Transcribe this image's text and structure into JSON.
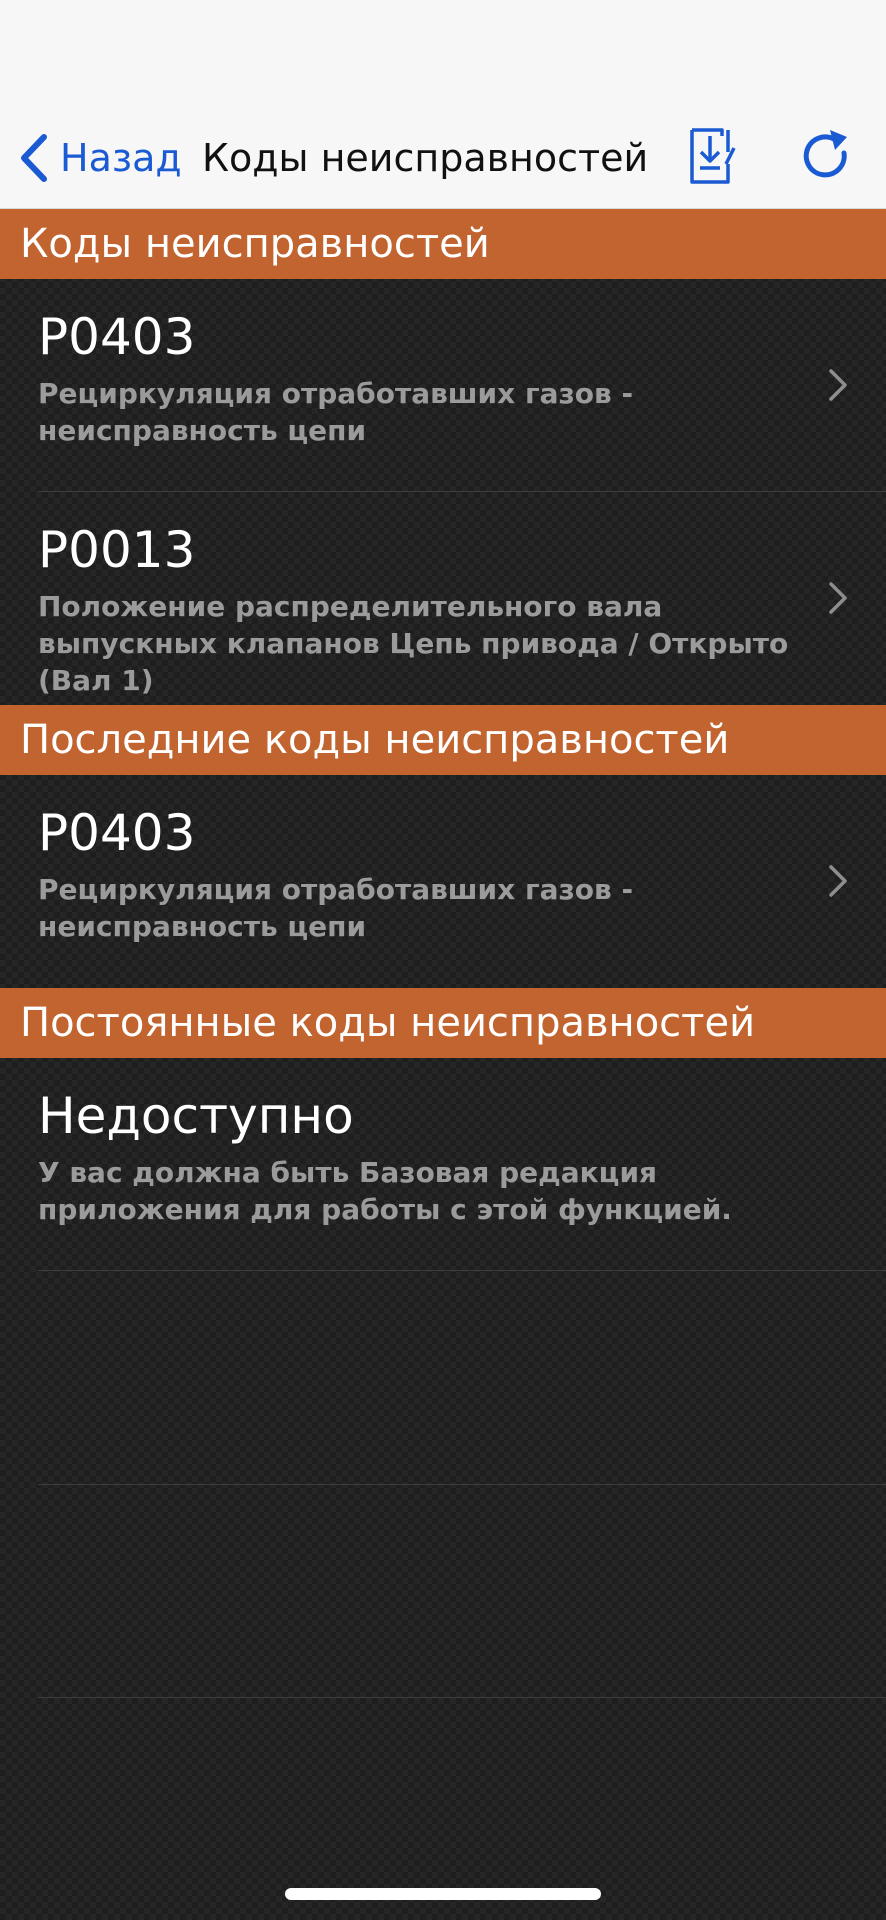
{
  "nav": {
    "back_label": "Назад",
    "title": "Коды неисправностей"
  },
  "sections": {
    "current": {
      "header": "Коды неисправностей",
      "items": [
        {
          "code": "P0403",
          "description": "Рециркуляция отработавших газов - неисправность цепи"
        },
        {
          "code": "P0013",
          "description": "Положение распределительного вала выпускных клапанов Цепь привода / Открыто (Вал 1)"
        }
      ]
    },
    "recent": {
      "header": "Последние коды неисправностей",
      "items": [
        {
          "code": "P0403",
          "description": "Рециркуляция отработавших газов - неисправность цепи"
        }
      ]
    },
    "permanent": {
      "header": "Постоянные коды неисправностей",
      "items": [
        {
          "code": "Недоступно",
          "description": "У вас должна быть Базовая редакция приложения для работы с этой функцией."
        }
      ]
    }
  },
  "colors": {
    "accent": "#1a5ad2",
    "section_header": "#c2642f",
    "background": "#262626",
    "description_text": "#9b9b9b"
  },
  "icons": {
    "back": "chevron-left-icon",
    "save": "download-document-icon",
    "refresh": "refresh-icon",
    "disclosure": "chevron-right-icon"
  }
}
